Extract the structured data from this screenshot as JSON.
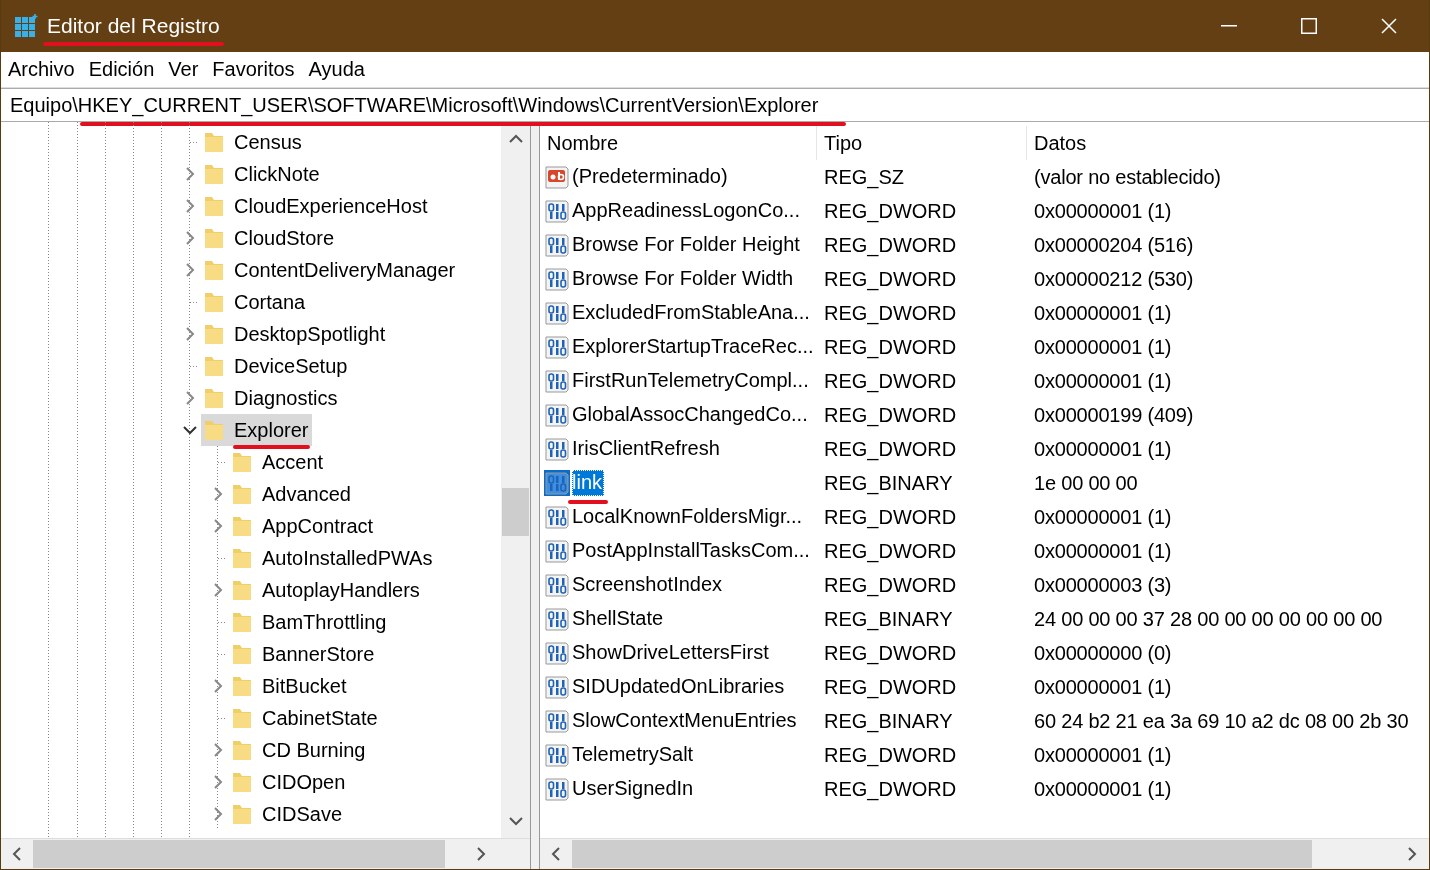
{
  "window": {
    "title": "Editor del Registro",
    "underlined": true
  },
  "menu": [
    "Archivo",
    "Edición",
    "Ver",
    "Favoritos",
    "Ayuda"
  ],
  "address": {
    "value": "Equipo\\HKEY_CURRENT_USER\\SOFTWARE\\Microsoft\\Windows\\CurrentVersion\\Explorer",
    "underlined": true
  },
  "tree": [
    {
      "label": "Census",
      "expandable": false,
      "selected": false
    },
    {
      "label": "ClickNote",
      "expandable": true,
      "selected": false
    },
    {
      "label": "CloudExperienceHost",
      "expandable": true,
      "selected": false
    },
    {
      "label": "CloudStore",
      "expandable": true,
      "selected": false
    },
    {
      "label": "ContentDeliveryManager",
      "expandable": true,
      "selected": false
    },
    {
      "label": "Cortana",
      "expandable": false,
      "selected": false
    },
    {
      "label": "DesktopSpotlight",
      "expandable": true,
      "selected": false
    },
    {
      "label": "DeviceSetup",
      "expandable": false,
      "selected": false
    },
    {
      "label": "Diagnostics",
      "expandable": true,
      "selected": false
    },
    {
      "label": "Explorer",
      "expandable": true,
      "selected": true,
      "underlined": true,
      "children": [
        {
          "label": "Accent",
          "expandable": false,
          "selected": false
        },
        {
          "label": "Advanced",
          "expandable": true,
          "selected": false
        },
        {
          "label": "AppContract",
          "expandable": true,
          "selected": false
        },
        {
          "label": "AutoInstalledPWAs",
          "expandable": false,
          "selected": false
        },
        {
          "label": "AutoplayHandlers",
          "expandable": true,
          "selected": false
        },
        {
          "label": "BamThrottling",
          "expandable": false,
          "selected": false
        },
        {
          "label": "BannerStore",
          "expandable": false,
          "selected": false
        },
        {
          "label": "BitBucket",
          "expandable": true,
          "selected": false
        },
        {
          "label": "CabinetState",
          "expandable": false,
          "selected": false
        },
        {
          "label": "CD Burning",
          "expandable": true,
          "selected": false
        },
        {
          "label": "CIDOpen",
          "expandable": true,
          "selected": false
        },
        {
          "label": "CIDSave",
          "expandable": true,
          "selected": false
        }
      ]
    }
  ],
  "values": {
    "columns": [
      "Nombre",
      "Tipo",
      "Datos"
    ],
    "rows": [
      {
        "kind": "text",
        "name": "(Predeterminado)",
        "type": "REG_SZ",
        "data": "(valor no establecido)",
        "selected": false
      },
      {
        "kind": "binary",
        "name": "AppReadinessLogonCo...",
        "type": "REG_DWORD",
        "data": "0x00000001 (1)",
        "selected": false
      },
      {
        "kind": "binary",
        "name": "Browse For Folder Height",
        "type": "REG_DWORD",
        "data": "0x00000204 (516)",
        "selected": false
      },
      {
        "kind": "binary",
        "name": "Browse For Folder Width",
        "type": "REG_DWORD",
        "data": "0x00000212 (530)",
        "selected": false
      },
      {
        "kind": "binary",
        "name": "ExcludedFromStableAna...",
        "type": "REG_DWORD",
        "data": "0x00000001 (1)",
        "selected": false
      },
      {
        "kind": "binary",
        "name": "ExplorerStartupTraceRec...",
        "type": "REG_DWORD",
        "data": "0x00000001 (1)",
        "selected": false
      },
      {
        "kind": "binary",
        "name": "FirstRunTelemetryCompl...",
        "type": "REG_DWORD",
        "data": "0x00000001 (1)",
        "selected": false
      },
      {
        "kind": "binary",
        "name": "GlobalAssocChangedCo...",
        "type": "REG_DWORD",
        "data": "0x00000199 (409)",
        "selected": false
      },
      {
        "kind": "binary",
        "name": "IrisClientRefresh",
        "type": "REG_DWORD",
        "data": "0x00000001 (1)",
        "selected": false
      },
      {
        "kind": "binary",
        "name": "link",
        "type": "REG_BINARY",
        "data": "1e 00 00 00",
        "selected": true,
        "underlined": true
      },
      {
        "kind": "binary",
        "name": "LocalKnownFoldersMigr...",
        "type": "REG_DWORD",
        "data": "0x00000001 (1)",
        "selected": false
      },
      {
        "kind": "binary",
        "name": "PostAppInstallTasksCom...",
        "type": "REG_DWORD",
        "data": "0x00000001 (1)",
        "selected": false
      },
      {
        "kind": "binary",
        "name": "ScreenshotIndex",
        "type": "REG_DWORD",
        "data": "0x00000003 (3)",
        "selected": false
      },
      {
        "kind": "binary",
        "name": "ShellState",
        "type": "REG_BINARY",
        "data": "24 00 00 00 37 28 00 00 00 00 00 00 00",
        "selected": false
      },
      {
        "kind": "binary",
        "name": "ShowDriveLettersFirst",
        "type": "REG_DWORD",
        "data": "0x00000000 (0)",
        "selected": false
      },
      {
        "kind": "binary",
        "name": "SIDUpdatedOnLibraries",
        "type": "REG_DWORD",
        "data": "0x00000001 (1)",
        "selected": false
      },
      {
        "kind": "binary",
        "name": "SlowContextMenuEntries",
        "type": "REG_BINARY",
        "data": "60 24 b2 21 ea 3a 69 10 a2 dc 08 00 2b 30",
        "selected": false
      },
      {
        "kind": "binary",
        "name": "TelemetrySalt",
        "type": "REG_DWORD",
        "data": "0x00000001 (1)",
        "selected": false
      },
      {
        "kind": "binary",
        "name": "UserSignedIn",
        "type": "REG_DWORD",
        "data": "0x00000001 (1)",
        "selected": false
      }
    ]
  }
}
